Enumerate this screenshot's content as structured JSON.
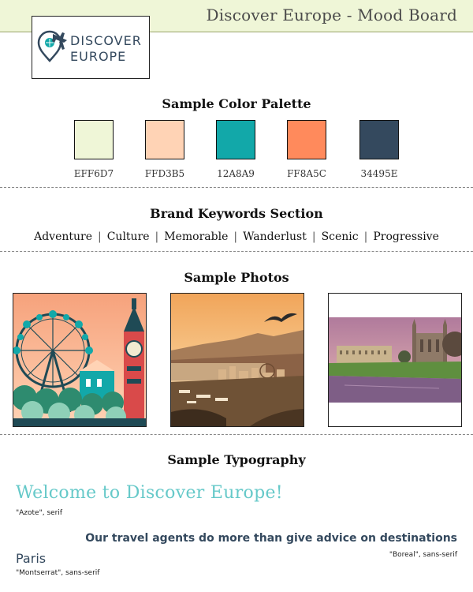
{
  "header": {
    "title": "Discover Europe - Mood Board"
  },
  "logo": {
    "line1": "DISCOVER",
    "line2": "EUROPE",
    "icon": "map-pin-plane-icon"
  },
  "palette": {
    "title": "Sample Color Palette",
    "colors": [
      {
        "hex": "#EFF6D7",
        "label": "EFF6D7"
      },
      {
        "hex": "#FFD3B5",
        "label": "FFD3B5"
      },
      {
        "hex": "#12A8A9",
        "label": "12A8A9"
      },
      {
        "hex": "#FF8A5C",
        "label": "FF8A5C"
      },
      {
        "hex": "#34495E",
        "label": "34495E"
      }
    ]
  },
  "keywords": {
    "title": "Brand Keywords Section",
    "items": [
      "Adventure",
      "Culture",
      "Memorable",
      "Wanderlust",
      "Scenic",
      "Progressive"
    ]
  },
  "photos": {
    "title": "Sample Photos",
    "items": [
      {
        "subject": "illustrated-ferris-wheel-clock-tower"
      },
      {
        "subject": "coastal-city-sunset-with-bird"
      },
      {
        "subject": "college-building-by-river-at-dusk"
      }
    ]
  },
  "typography": {
    "title": "Sample Typography",
    "heading_sample": "Welcome to Discover Europe!",
    "heading_font": "\"Azote\", serif",
    "body_sample": "Our travel agents do more than give advice on destinations",
    "body_font": "\"Boreal\", sans-serif",
    "small_sample": "Paris",
    "small_font": "\"Montserrat\", sans-serif"
  }
}
